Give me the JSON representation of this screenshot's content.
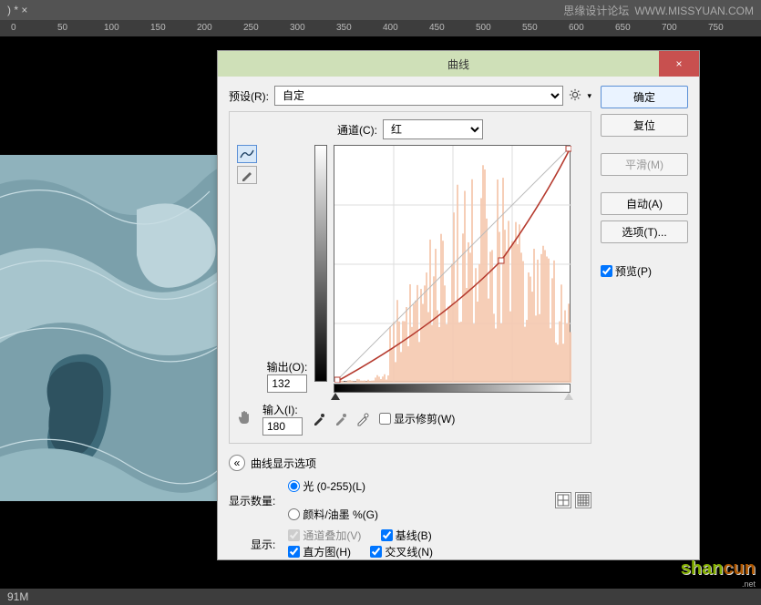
{
  "topbar": {
    "tab": ") * ×",
    "forum": "思缘设计论坛",
    "url": "WWW.MISSYUAN.COM"
  },
  "ruler": {
    "marks": [
      0,
      50,
      100,
      150,
      200,
      250,
      300,
      350,
      400,
      450,
      500,
      550,
      600,
      650,
      700,
      750
    ]
  },
  "statusbar": {
    "text": "91M"
  },
  "dialog": {
    "title": "曲线",
    "close": "×",
    "preset_label": "预设(R):",
    "preset_value": "自定",
    "channel_label": "通道(C):",
    "channel_value": "红",
    "output_label": "输出(O):",
    "output_value": "132",
    "input_label": "输入(I):",
    "input_value": "180",
    "show_clip": "显示修剪(W)",
    "options_header": "曲线显示选项",
    "show_amount_label": "显示数量:",
    "light_label": "光 (0-255)(L)",
    "pigment_label": "颜料/油墨 %(G)",
    "show_label": "显示:",
    "channel_overlay": "通道叠加(V)",
    "baseline": "基线(B)",
    "histogram": "直方图(H)",
    "intersection": "交叉线(N)",
    "buttons": {
      "ok": "确定",
      "cancel": "复位",
      "smooth": "平滑(M)",
      "auto": "自动(A)",
      "options": "选项(T)...",
      "preview": "预览(P)"
    }
  },
  "chart_data": {
    "type": "line",
    "title": "曲线 (Curves) — 红通道",
    "xlabel": "输入",
    "ylabel": "输出",
    "xlim": [
      0,
      255
    ],
    "ylim": [
      0,
      255
    ],
    "series": [
      {
        "name": "曲线",
        "x": [
          0,
          180,
          255
        ],
        "values": [
          0,
          132,
          255
        ]
      },
      {
        "name": "基线",
        "x": [
          0,
          255
        ],
        "values": [
          0,
          255
        ]
      }
    ],
    "histogram_peak_region": [
      120,
      220
    ]
  },
  "watermark": {
    "p1": "shan",
    "p2": "cun",
    "sub": ".net"
  }
}
